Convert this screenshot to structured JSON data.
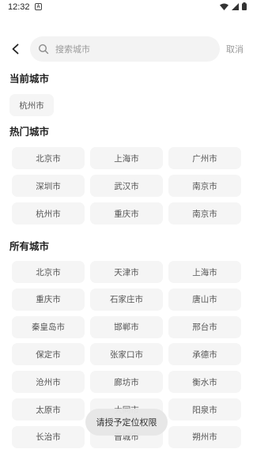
{
  "status_bar": {
    "time": "12:32",
    "notification": "A"
  },
  "search": {
    "placeholder": "搜索城市",
    "cancel_label": "取消"
  },
  "sections": {
    "current_title": "当前城市",
    "current_city": "杭州市",
    "hot_title": "热门城市",
    "hot_cities": [
      "北京市",
      "上海市",
      "广州市",
      "深圳市",
      "武汉市",
      "南京市",
      "杭州市",
      "重庆市",
      "南京市"
    ],
    "all_title": "所有城市",
    "all_cities": [
      "北京市",
      "天津市",
      "上海市",
      "重庆市",
      "石家庄市",
      "唐山市",
      "秦皇岛市",
      "邯郸市",
      "邢台市",
      "保定市",
      "张家口市",
      "承德市",
      "沧州市",
      "廊坊市",
      "衡水市",
      "太原市",
      "大同市",
      "阳泉市",
      "长治市",
      "晋城市",
      "朔州市"
    ]
  },
  "toast": {
    "text": "请授予定位权限"
  },
  "colors": {
    "chip_bg": "#f5f5f5",
    "search_bg": "#f3f3f3",
    "text_muted": "#9a9a9a"
  }
}
